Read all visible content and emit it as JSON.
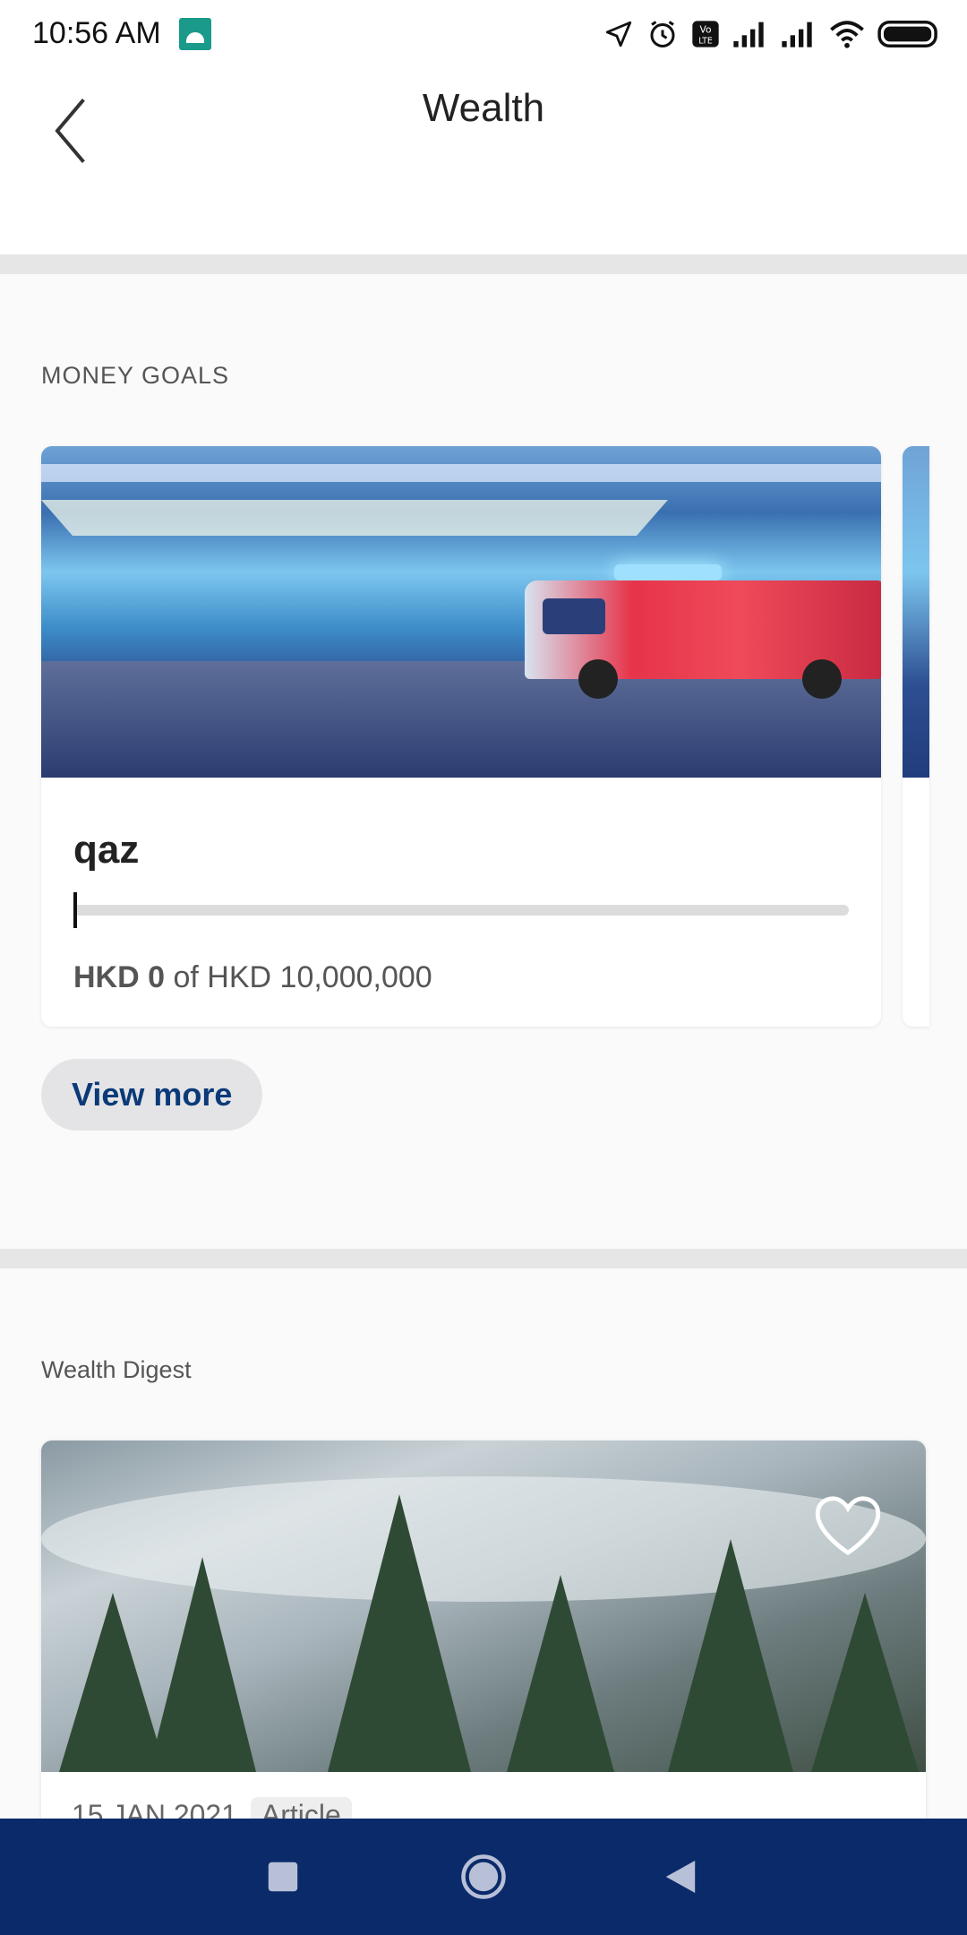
{
  "status_bar": {
    "time": "10:56 AM",
    "icons": [
      "android-icon",
      "location-icon",
      "alarm-icon",
      "volte-icon",
      "signal-icon",
      "signal-icon",
      "wifi-icon",
      "battery-icon"
    ]
  },
  "header": {
    "title": "Wealth",
    "back_icon": "chevron-left-icon"
  },
  "money_goals": {
    "section_label": "MONEY GOALS",
    "goals": [
      {
        "name": "qaz",
        "current": "HKD 0",
        "separator": "of",
        "target": "HKD 10,000,000",
        "progress_fraction": 0.0
      }
    ],
    "view_more_label": "View more"
  },
  "wealth_digest": {
    "section_label": "Wealth Digest",
    "articles": [
      {
        "date": "15 JAN 2021",
        "tag": "Article",
        "favorite_icon": "heart-outline-icon"
      }
    ]
  },
  "nav_bar": {
    "icons": [
      "recent-apps-icon",
      "home-icon",
      "back-icon"
    ]
  },
  "colors": {
    "accent": "#0b3a78",
    "nav_bar": "#0a2a6a",
    "divider": "#e6e6e6"
  }
}
